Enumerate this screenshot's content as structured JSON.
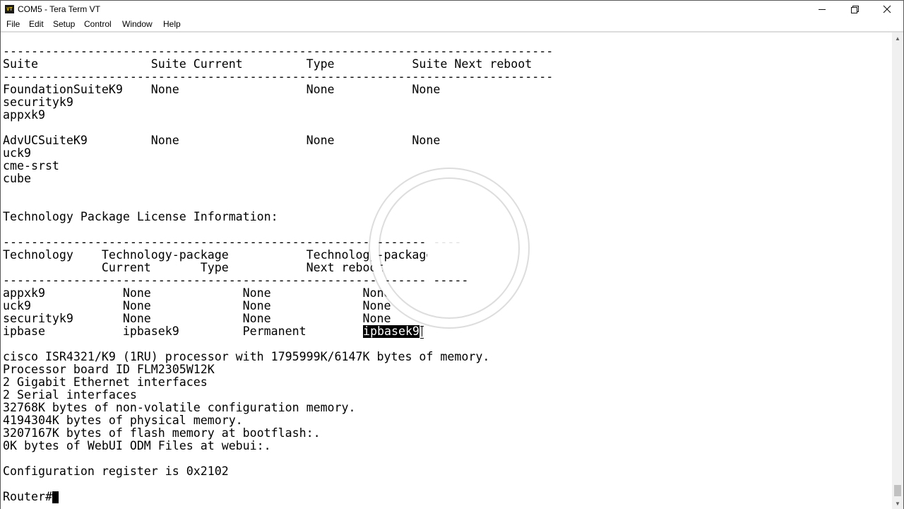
{
  "window": {
    "title": "COM5 - Tera Term VT",
    "icon_text": "VT",
    "controls": {
      "minimize": "minimize-icon",
      "maximize": "restore-icon",
      "close": "close-icon"
    }
  },
  "menu": [
    "File",
    "Edit",
    "Setup",
    "Control",
    "Window",
    "Help"
  ],
  "terminal": {
    "lines": [
      "------------------------------------------------------------------------------",
      "Suite                Suite Current         Type           Suite Next reboot",
      "------------------------------------------------------------------------------",
      "FoundationSuiteK9    None                  None           None",
      "securityk9",
      "appxk9",
      "",
      "AdvUCSuiteK9         None                  None           None",
      "uck9",
      "cme-srst",
      "cube",
      "",
      "",
      "Technology Package License Information:",
      "",
      "-----------------------------------------------------------------",
      "Technology    Technology-package           Technology-package",
      "              Current       Type           Next reboot",
      "------------------------------------------------------------------",
      "appxk9           None             None             None",
      "uck9             None             None             None",
      "securityk9       None             None             None",
      "ipbase           ipbasek9         Permanent        ",
      "",
      "cisco ISR4321/K9 (1RU) processor with 1795999K/6147K bytes of memory.",
      "Processor board ID FLM2305W12K",
      "2 Gigabit Ethernet interfaces",
      "2 Serial interfaces",
      "32768K bytes of non-volatile configuration memory.",
      "4194304K bytes of physical memory.",
      "3207167K bytes of flash memory at bootflash:.",
      "0K bytes of WebUI ODM Files at webui:.",
      "",
      "Configuration register is 0x2102",
      "",
      "Router#"
    ],
    "selected_text": "ipbasek9",
    "selected_line_index": 22,
    "prompt_line_index": 35
  },
  "overlay": {
    "icon": "play-icon",
    "color": "#ffffff"
  },
  "colors": {
    "terminal_bg": "#ffffff",
    "terminal_fg": "#000000",
    "selection_bg": "#000000",
    "selection_fg": "#ffffff"
  }
}
